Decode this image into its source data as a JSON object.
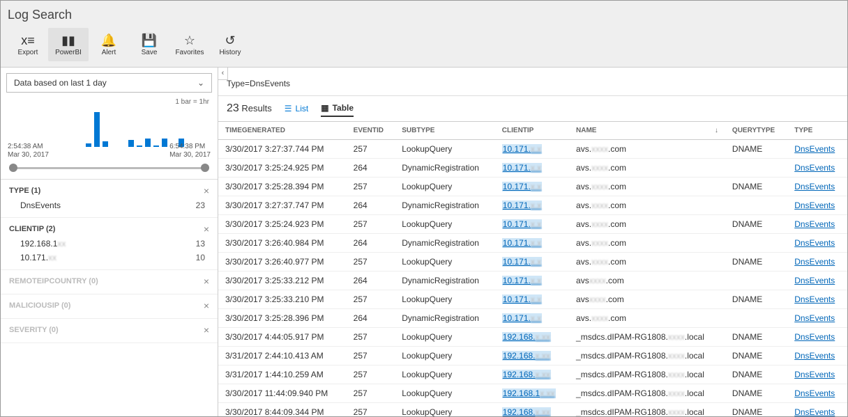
{
  "header": {
    "title": "Log Search",
    "toolbar": [
      {
        "id": "export",
        "label": "Export",
        "icon": "xls"
      },
      {
        "id": "powerbi",
        "label": "PowerBI",
        "icon": "powerbi",
        "selected": true
      },
      {
        "id": "alert",
        "label": "Alert",
        "icon": "bell"
      },
      {
        "id": "save",
        "label": "Save",
        "icon": "save"
      },
      {
        "id": "favorites",
        "label": "Favorites",
        "icon": "star"
      },
      {
        "id": "history",
        "label": "History",
        "icon": "history"
      }
    ]
  },
  "sidebar": {
    "timeframe_label": "Data based on last 1 day",
    "bar_scale": "1 bar = 1hr",
    "time_axis": {
      "start_top": "2:54:38 AM",
      "start_bottom": "Mar 30, 2017",
      "end_top": "6:54:38 PM",
      "end_bottom": "Mar 30, 2017"
    },
    "facets": [
      {
        "name": "TYPE",
        "count": 1,
        "items": [
          {
            "label": "DnsEvents",
            "count": 23
          }
        ]
      },
      {
        "name": "CLIENTIP",
        "count": 2,
        "items": [
          {
            "label": "192.168.1",
            "obsc": "xx",
            "count": 13
          },
          {
            "label": "10.171.",
            "obsc": "xx",
            "count": 10
          }
        ]
      },
      {
        "name": "REMOTEIPCOUNTRY",
        "count": 0,
        "dim": true
      },
      {
        "name": "MALICIOUSIP",
        "count": 0,
        "dim": true
      },
      {
        "name": "SEVERITY",
        "count": 0,
        "dim": true
      }
    ]
  },
  "chart_data": {
    "type": "bar",
    "title": "",
    "xlabel": "",
    "ylabel": "",
    "values": [
      0,
      0,
      0,
      0,
      0,
      0,
      0,
      0,
      0,
      5,
      50,
      8,
      0,
      0,
      10,
      2,
      12,
      2,
      12,
      0,
      12,
      0,
      0,
      0
    ],
    "ylim": [
      0,
      55
    ]
  },
  "main": {
    "query": "Type=DnsEvents",
    "result_count": "23",
    "result_label": "Results",
    "view_list": "List",
    "view_table": "Table",
    "columns": [
      "TIMEGENERATED",
      "EVENTID",
      "SUBTYPE",
      "CLIENTIP",
      "NAME",
      "QUERYTYPE",
      "TYPE"
    ],
    "sort_col": "NAME",
    "rows": [
      {
        "time": "3/30/2017 3:27:37.744 PM",
        "eventid": "257",
        "subtype": "LookupQuery",
        "clientip": "10.171.",
        "cobsc": "x.x",
        "name": "avs.",
        "nobsc": "xxxx",
        ".com": ".com",
        "qtype": "DNAME",
        "type": "DnsEvents"
      },
      {
        "time": "3/30/2017 3:25:24.925 PM",
        "eventid": "264",
        "subtype": "DynamicRegistration",
        "clientip": "10.171.",
        "cobsc": "x.x",
        "name": "avs.",
        "nobsc": "xxxx",
        ".com": ".com",
        "qtype": "",
        "type": "DnsEvents"
      },
      {
        "time": "3/30/2017 3:25:28.394 PM",
        "eventid": "257",
        "subtype": "LookupQuery",
        "clientip": "10.171.",
        "cobsc": "x.x",
        "name": "avs.",
        "nobsc": "xxxx",
        ".com": ".com",
        "qtype": "DNAME",
        "type": "DnsEvents"
      },
      {
        "time": "3/30/2017 3:27:37.747 PM",
        "eventid": "264",
        "subtype": "DynamicRegistration",
        "clientip": "10.171.",
        "cobsc": "x.x",
        "name": "avs.",
        "nobsc": "xxxx",
        ".com": ".com",
        "qtype": "",
        "type": "DnsEvents"
      },
      {
        "time": "3/30/2017 3:25:24.923 PM",
        "eventid": "257",
        "subtype": "LookupQuery",
        "clientip": "10.171.",
        "cobsc": "x.x",
        "name": "avs.",
        "nobsc": "xxxx",
        ".com": ".com",
        "qtype": "DNAME",
        "type": "DnsEvents"
      },
      {
        "time": "3/30/2017 3:26:40.984 PM",
        "eventid": "264",
        "subtype": "DynamicRegistration",
        "clientip": "10.171.",
        "cobsc": "x.x",
        "name": "avs.",
        "nobsc": "xxxx",
        ".com": ".com",
        "qtype": "",
        "type": "DnsEvents"
      },
      {
        "time": "3/30/2017 3:26:40.977 PM",
        "eventid": "257",
        "subtype": "LookupQuery",
        "clientip": "10.171.",
        "cobsc": "x.x",
        "name": "avs.",
        "nobsc": "xxxx",
        ".com": ".com",
        "qtype": "DNAME",
        "type": "DnsEvents"
      },
      {
        "time": "3/30/2017 3:25:33.212 PM",
        "eventid": "264",
        "subtype": "DynamicRegistration",
        "clientip": "10.171.",
        "cobsc": "x.x",
        "name": "avs",
        "nobsc": "xxxx",
        ".com": ".com",
        "qtype": "",
        "type": "DnsEvents"
      },
      {
        "time": "3/30/2017 3:25:33.210 PM",
        "eventid": "257",
        "subtype": "LookupQuery",
        "clientip": "10.171.",
        "cobsc": "x.x",
        "name": "avs",
        "nobsc": "xxxx",
        ".com": ".com",
        "qtype": "DNAME",
        "type": "DnsEvents"
      },
      {
        "time": "3/30/2017 3:25:28.396 PM",
        "eventid": "264",
        "subtype": "DynamicRegistration",
        "clientip": "10.171.",
        "cobsc": "x.x",
        "name": "avs.",
        "nobsc": "xxxx",
        ".com": ".com",
        "qtype": "",
        "type": "DnsEvents"
      },
      {
        "time": "3/30/2017 4:44:05.917 PM",
        "eventid": "257",
        "subtype": "LookupQuery",
        "clientip": "192.168.",
        "cobsc": "x.xx",
        "name": "_msdcs.dIPAM-RG1808.",
        "nobsc": "xxxx",
        ".com": ".local",
        "qtype": "DNAME",
        "type": "DnsEvents"
      },
      {
        "time": "3/31/2017 2:44:10.413 AM",
        "eventid": "257",
        "subtype": "LookupQuery",
        "clientip": "192.168.",
        "cobsc": "x.xx",
        "name": "_msdcs.dIPAM-RG1808.",
        "nobsc": "xxxx",
        ".com": ".local",
        "qtype": "DNAME",
        "type": "DnsEvents"
      },
      {
        "time": "3/31/2017 1:44:10.259 AM",
        "eventid": "257",
        "subtype": "LookupQuery",
        "clientip": "192.168.",
        "cobsc": "x.xx",
        "name": "_msdcs.dIPAM-RG1808.",
        "nobsc": "xxxx",
        ".com": ".local",
        "qtype": "DNAME",
        "type": "DnsEvents"
      },
      {
        "time": "3/30/2017 11:44:09.940 PM",
        "eventid": "257",
        "subtype": "LookupQuery",
        "clientip": "192.168.1",
        "cobsc": "x.xx",
        "name": "_msdcs.dIPAM-RG1808.",
        "nobsc": "xxxx",
        ".com": ".local",
        "qtype": "DNAME",
        "type": "DnsEvents"
      },
      {
        "time": "3/30/2017 8:44:09.344 PM",
        "eventid": "257",
        "subtype": "LookupQuery",
        "clientip": "192.168.",
        "cobsc": "x.xx",
        "name": "_msdcs.dIPAM-RG1808.",
        "nobsc": "xxxx",
        ".com": ".local",
        "qtype": "DNAME",
        "type": "DnsEvents"
      }
    ]
  }
}
